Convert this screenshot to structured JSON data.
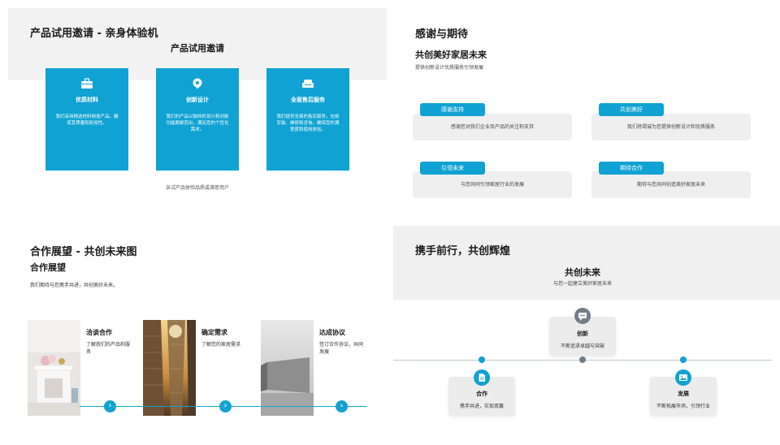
{
  "colors": {
    "accent": "#10a2d2",
    "grey_band": "#f2f2f2",
    "card_grey": "#efefef",
    "icon_grey": "#727f8a"
  },
  "slide1": {
    "title": "产品试用邀请 - 亲身体验机",
    "subtitle": "产品试用邀请",
    "cards": [
      {
        "icon": "briefcase-icon",
        "title": "优质材料",
        "desc": "我们采用精选材料制造产品，确保其质量和耐用性。"
      },
      {
        "icon": "location-pin-icon",
        "title": "创新设计",
        "desc": "我们的产品以独特的设计和创新功能脱颖而出，满足您的个性化需求。"
      },
      {
        "icon": "sofa-icon",
        "title": "全面售后服务",
        "desc": "我们提供全面的售后服务，包括安装、维修和咨询，确保您的满意度和使用体验。"
      }
    ],
    "footer": "亲试产品体验品质或满意用户"
  },
  "slide2": {
    "title": "感谢与期待",
    "subtitle": "共创美好家居未来",
    "desc": "提供创新设计优质服务引领发展",
    "items": [
      {
        "tag": "感谢支持",
        "text": "感谢您对我们企业及产品的关注和支持"
      },
      {
        "tag": "共创美好",
        "text": "我们将竭诚为您提供创新设计和优质服务"
      },
      {
        "tag": "引领未来",
        "text": "与您共同引领家居行业的发展"
      },
      {
        "tag": "期待合作",
        "text": "期待与您共同创造美好家居未来"
      }
    ]
  },
  "slide3": {
    "title": "合作展望 - 共创未来图",
    "subtitle": "合作展望",
    "desc": "我们期待与您携手共进，共创美好未来。",
    "steps": [
      {
        "title": "洽谈合作",
        "desc": "了解我们的产品和服务",
        "photo": "white-fireplace-interior"
      },
      {
        "title": "确定需求",
        "desc": "了解您的家居需求",
        "photo": "glass-skyscrapers-sunset"
      },
      {
        "title": "达成协议",
        "desc": "签订合作协议，共同发展",
        "photo": "concrete-wall-grey"
      }
    ],
    "arrow_glyph": "›"
  },
  "slide4": {
    "title": "携手前行，共创辉煌",
    "subtitle": "共创未来",
    "desc": "与您一起建立美好家居未来",
    "cards": [
      {
        "icon": "chat-bubble-icon",
        "title": "创新",
        "desc": "不断追求卓越与突破"
      },
      {
        "icon": "document-icon",
        "title": "合作",
        "desc": "携手共进，实现双赢"
      },
      {
        "icon": "image-icon",
        "title": "发展",
        "desc": "不断拓展市场，引领行业"
      }
    ]
  }
}
